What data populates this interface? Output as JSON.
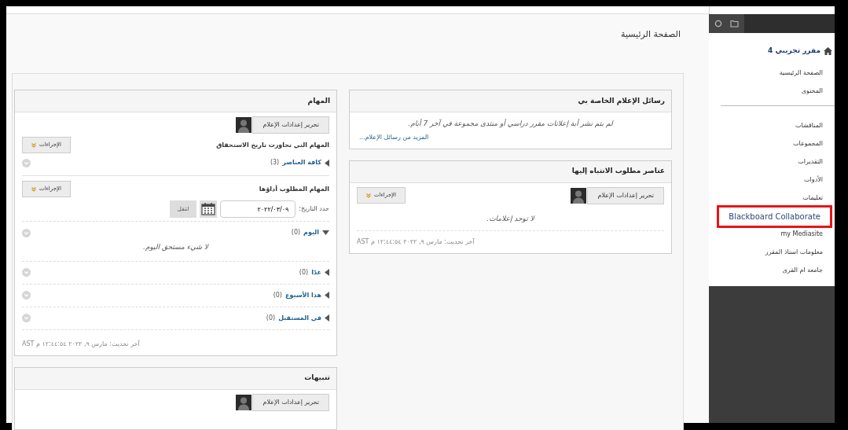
{
  "page_title": "الصفحة الرئيسية",
  "sidebar": {
    "course_title": "مقرر تجريبي 4",
    "groups": [
      [
        {
          "label": "الصفحة الرئيسية",
          "highlighted": false
        },
        {
          "label": "المحتوى",
          "highlighted": false
        }
      ],
      [
        {
          "label": "المناقشات",
          "highlighted": false
        },
        {
          "label": "المجموعات",
          "highlighted": false
        },
        {
          "label": "التقديرات",
          "highlighted": false
        },
        {
          "label": "الأدوات",
          "highlighted": false
        },
        {
          "label": "تعليمات",
          "highlighted": false
        },
        {
          "label": "Blackboard Collaborate",
          "highlighted": true
        },
        {
          "label": "my Mediasite",
          "highlighted": false
        },
        {
          "label": "معلومات استاذ المقرر",
          "highlighted": false
        },
        {
          "label": "جامعة ام القرى",
          "highlighted": false
        }
      ]
    ]
  },
  "announcements": {
    "title": "رسائل الإعلام الخاصة بي",
    "message": "لم يتم نشر أية إعلانات مقرر دراسي أو منتدى مجموعة في آخر 7 أيام.",
    "link": "المزيد من رسائل الإعلام..."
  },
  "needs_attention": {
    "title": "عناصر مطلوب الانتباه إليها",
    "edit_button": "تحرير إعدادات الإعلام",
    "actions_button": "الإجراءات",
    "message": "لا توجد إعلامات.",
    "last_updated": "آخر تحديث: مارس ٩, ٢٠٢٢ ١٢:٤٤:٥٤ م AST"
  },
  "tasks": {
    "title": "المهام",
    "edit_button": "تحرير إعدادات الإعلام",
    "overdue": {
      "title": "المهام التي تجاوزت تاريخ الاستحقاق",
      "actions_button": "الإجراءات",
      "groups": [
        {
          "label": "كافة العناصر",
          "count": "(3)",
          "expanded": false
        }
      ]
    },
    "due": {
      "title": "المهام المطلوب أداؤها",
      "actions_button": "الإجراءات",
      "date_label": "حدد التاريخ:",
      "date_value": "٢٠٢٢/٠٣/٠٩",
      "go_button": "انتقل",
      "groups": [
        {
          "label": "اليوم",
          "count": "(0)",
          "expanded": true,
          "empty_message": "لا شيء مستحق اليوم."
        },
        {
          "label": "غدًا",
          "count": "(0)",
          "expanded": false
        },
        {
          "label": "هذا الأسبوع",
          "count": "(0)",
          "expanded": false
        },
        {
          "label": "في المستقبل",
          "count": "(0)",
          "expanded": false
        }
      ]
    },
    "last_updated": "آخر تحديث: مارس ٩, ٢٠٢٢ ١٢:٤٤:٥٤ م AST"
  },
  "alerts": {
    "title": "تنبيهات",
    "edit_button": "تحرير إعدادات الإعلام"
  }
}
